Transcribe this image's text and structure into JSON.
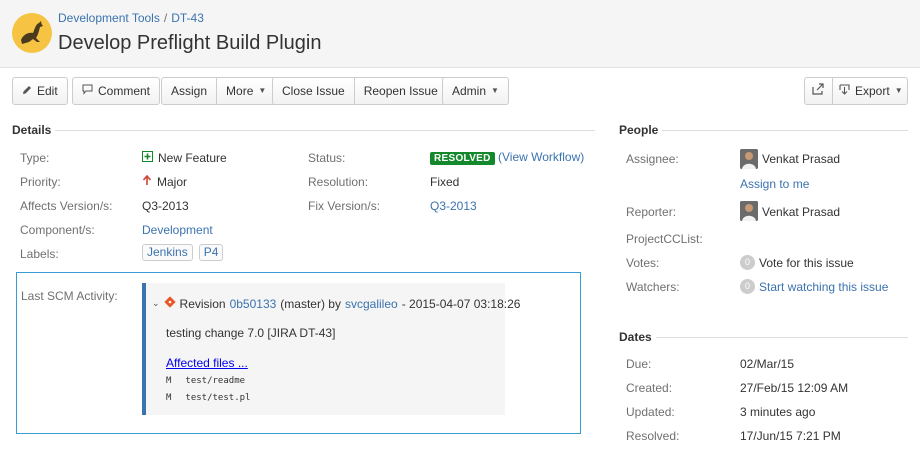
{
  "breadcrumbs": {
    "project": "Development Tools",
    "separator": "/",
    "issue_key": "DT-43"
  },
  "issue_title": "Develop Preflight Build Plugin",
  "toolbar": {
    "edit": "Edit",
    "comment": "Comment",
    "assign": "Assign",
    "more": "More",
    "close_issue": "Close Issue",
    "reopen_issue": "Reopen Issue",
    "admin": "Admin",
    "export": "Export"
  },
  "details": {
    "heading": "Details",
    "type": {
      "label": "Type:",
      "value": "New Feature"
    },
    "priority": {
      "label": "Priority:",
      "value": "Major"
    },
    "affects_version": {
      "label": "Affects Version/s:",
      "value": "Q3-2013"
    },
    "components": {
      "label": "Component/s:",
      "value": "Development"
    },
    "labels": {
      "label": "Labels:",
      "values": [
        "Jenkins",
        "P4"
      ]
    },
    "status": {
      "label": "Status:",
      "value": "RESOLVED",
      "workflow_link": "(View Workflow)"
    },
    "resolution": {
      "label": "Resolution:",
      "value": "Fixed"
    },
    "fix_version": {
      "label": "Fix Version/s:",
      "value": "Q3-2013"
    }
  },
  "scm": {
    "label": "Last SCM Activity:",
    "revision_label": "Revision",
    "revision_id": "0b50133",
    "branch": "(master) by",
    "author": "svcgalileo",
    "timestamp": "- 2015-04-07 03:18:26",
    "message": "testing change 7.0 [JIRA DT-43]",
    "affected_files_link": "Affected files ...",
    "files": [
      {
        "mode": "M",
        "path": "test/readme"
      },
      {
        "mode": "M",
        "path": "test/test.pl"
      }
    ]
  },
  "people": {
    "heading": "People",
    "assignee": {
      "label": "Assignee:",
      "name": "Venkat Prasad",
      "assign_to_me": "Assign to me"
    },
    "reporter": {
      "label": "Reporter:",
      "name": "Venkat Prasad"
    },
    "projectcclist": {
      "label": "ProjectCCList:"
    },
    "votes": {
      "label": "Votes:",
      "count": "0",
      "text": "Vote for this issue"
    },
    "watchers": {
      "label": "Watchers:",
      "count": "0",
      "text": "Start watching this issue"
    }
  },
  "dates": {
    "heading": "Dates",
    "due": {
      "label": "Due:",
      "value": "02/Mar/15"
    },
    "created": {
      "label": "Created:",
      "value": "27/Feb/15 12:09 AM"
    },
    "updated": {
      "label": "Updated:",
      "value": "3 minutes ago"
    },
    "resolved": {
      "label": "Resolved:",
      "value": "17/Jun/15 7:21 PM"
    }
  },
  "colors": {
    "link": "#3b73af",
    "resolved_badge": "#14892c",
    "logo_bg": "#f6c342",
    "priority_arrow": "#d04437",
    "scm_border": "#3b9bd6"
  }
}
